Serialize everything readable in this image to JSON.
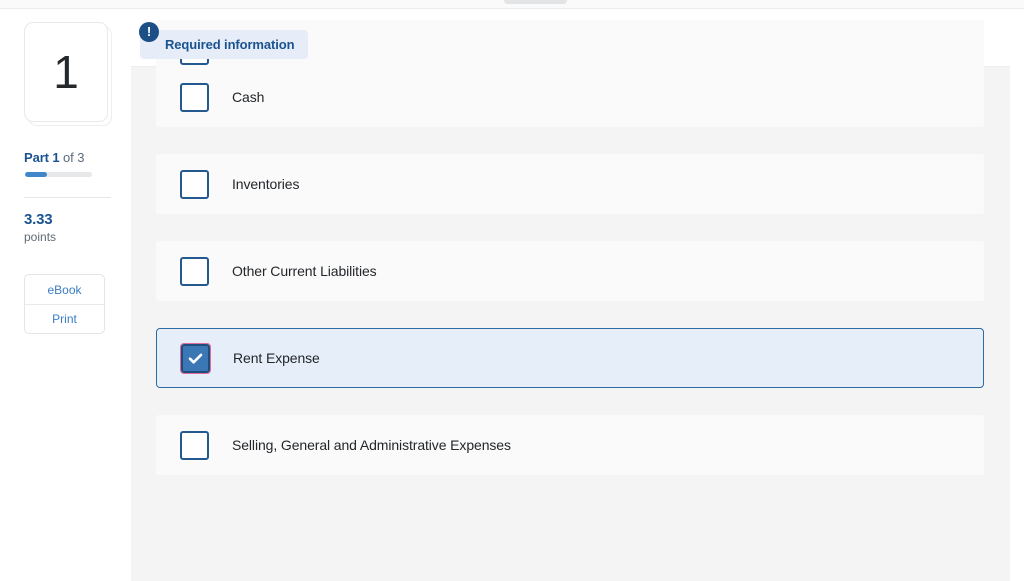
{
  "window": {
    "drag_handle": "window-drag-handle"
  },
  "sidebar": {
    "question_number": "1",
    "part_strong": "Part 1",
    "part_muted": " of 3",
    "progress_percent": 33,
    "points_value": "3.33",
    "points_label": "points",
    "tools": [
      {
        "label": "eBook",
        "name": "ebook-button"
      },
      {
        "label": "Print",
        "name": "print-button"
      }
    ]
  },
  "banner": {
    "icon": "exclamation-icon",
    "icon_glyph": "!",
    "label": "Required information"
  },
  "options": [
    {
      "label": "",
      "checked": false,
      "partial": true
    },
    {
      "label": "Cash",
      "checked": false,
      "partial": false
    },
    {
      "label": "Inventories",
      "checked": false,
      "partial": false
    },
    {
      "label": "Other Current Liabilities",
      "checked": false,
      "partial": false
    },
    {
      "label": "Rent Expense",
      "checked": true,
      "partial": false
    },
    {
      "label": "Selling, General and Administrative Expenses",
      "checked": false,
      "partial": false
    }
  ],
  "colors": {
    "accent_blue": "#1b5390",
    "link_blue": "#3b7cc4",
    "progress_fill": "#3f87c9",
    "checkbox_border": "#23598f",
    "checkbox_checked_bg": "#3b76b5",
    "focus_ring": "#e06a9a",
    "selected_row_bg": "#e6eef9",
    "selected_row_border": "#2d6ca3",
    "banner_bg": "#e6edf8",
    "badge_bg": "#1b4f86",
    "panel_bg": "#f4f4f5",
    "row_bg": "#fafafa"
  }
}
